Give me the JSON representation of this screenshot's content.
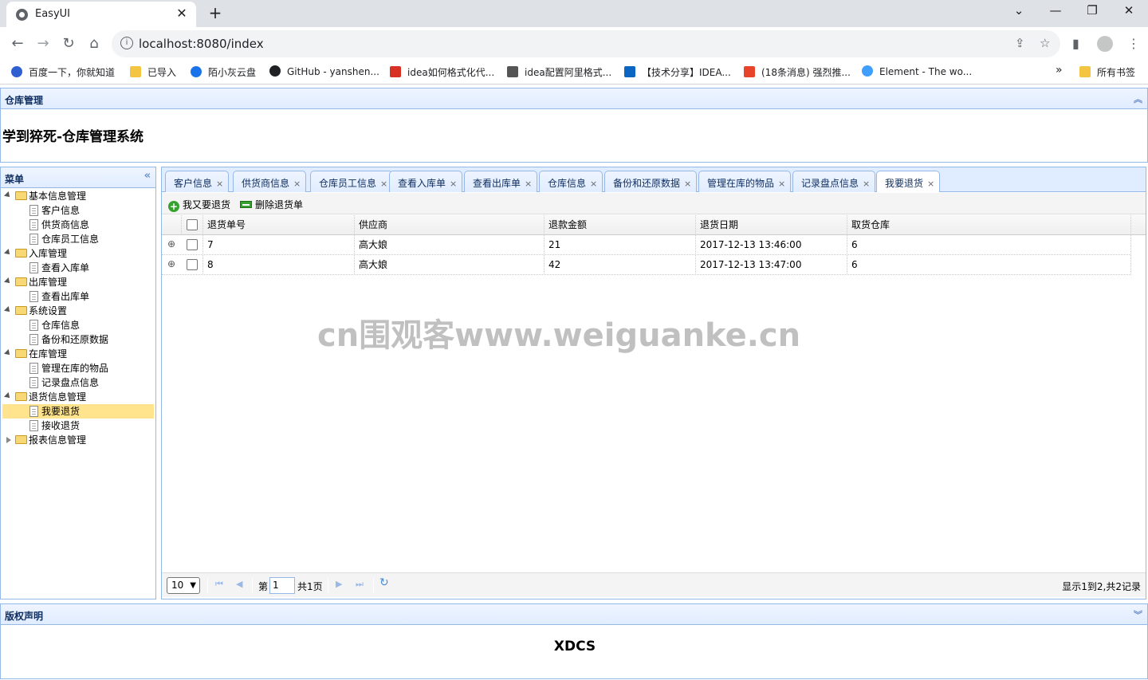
{
  "browser": {
    "tab_title": "EasyUI",
    "tab_close": "✕",
    "new_tab": "+",
    "url": "localhost:8080/index",
    "bookmarks": [
      {
        "label": "百度一下，你就知道",
        "color": "#2f5fd0"
      },
      {
        "label": "已导入",
        "color": "#f4c542"
      },
      {
        "label": "陌小灰云盘",
        "color": "#1a73e8"
      },
      {
        "label": "GitHub - yanshen...",
        "color": "#202124"
      },
      {
        "label": "idea如何格式化代...",
        "color": "#d93025"
      },
      {
        "label": "idea配置阿里格式...",
        "color": "#555555"
      },
      {
        "label": "【技术分享】IDEA...",
        "color": "#0a66c2"
      },
      {
        "label": "(18条消息) 强烈推...",
        "color": "#e8442a"
      },
      {
        "label": "Element - The wo...",
        "color": "#409eff"
      }
    ],
    "bookmarks_more": "»",
    "all_bookmarks": "所有书签"
  },
  "header": {
    "title": "仓库管理",
    "system_name": "学到猝死-仓库管理系统"
  },
  "menu": {
    "title": "菜单",
    "nodes": [
      {
        "label": "基本信息管理",
        "type": "folder",
        "level": 0,
        "open": true
      },
      {
        "label": "客户信息",
        "type": "file",
        "level": 1
      },
      {
        "label": "供货商信息",
        "type": "file",
        "level": 1
      },
      {
        "label": "仓库员工信息",
        "type": "file",
        "level": 1
      },
      {
        "label": "入库管理",
        "type": "folder",
        "level": 0,
        "open": true
      },
      {
        "label": "查看入库单",
        "type": "file",
        "level": 1
      },
      {
        "label": "出库管理",
        "type": "folder",
        "level": 0,
        "open": true
      },
      {
        "label": "查看出库单",
        "type": "file",
        "level": 1
      },
      {
        "label": "系统设置",
        "type": "folder",
        "level": 0,
        "open": true
      },
      {
        "label": "仓库信息",
        "type": "file",
        "level": 1
      },
      {
        "label": "备份和还原数据",
        "type": "file",
        "level": 1
      },
      {
        "label": "在库管理",
        "type": "folder",
        "level": 0,
        "open": true
      },
      {
        "label": "管理在库的物品",
        "type": "file",
        "level": 1
      },
      {
        "label": "记录盘点信息",
        "type": "file",
        "level": 1
      },
      {
        "label": "退货信息管理",
        "type": "folder",
        "level": 0,
        "open": true
      },
      {
        "label": "我要退货",
        "type": "file",
        "level": 1,
        "selected": true
      },
      {
        "label": "接收退货",
        "type": "file",
        "level": 1
      },
      {
        "label": "报表信息管理",
        "type": "folder",
        "level": 0,
        "open": false
      }
    ]
  },
  "tabs": [
    {
      "label": "客户信息"
    },
    {
      "label": "供货商信息"
    },
    {
      "label": "仓库员工信息"
    },
    {
      "label": "查看入库单"
    },
    {
      "label": "查看出库单"
    },
    {
      "label": "仓库信息"
    },
    {
      "label": "备份和还原数据"
    },
    {
      "label": "管理在库的物品"
    },
    {
      "label": "记录盘点信息"
    },
    {
      "label": "我要退货",
      "active": true
    }
  ],
  "tab_close_glyph": "×",
  "grid": {
    "toolbar": {
      "add_label": "我又要退货",
      "delete_label": "删除退货单"
    },
    "columns": [
      "退货单号",
      "供应商",
      "退款金额",
      "退货日期",
      "取货仓库"
    ],
    "rows": [
      [
        "7",
        "高大娘",
        "21",
        "2017-12-13 13:46:00",
        "6"
      ],
      [
        "8",
        "高大娘",
        "42",
        "2017-12-13 13:47:00",
        "6"
      ]
    ],
    "pager": {
      "page_size": "10",
      "page_prefix": "第",
      "page_value": "1",
      "page_total": "共1页",
      "summary": "显示1到2,共2记录"
    }
  },
  "watermark": "cn围观客www.weiguanke.cn",
  "footer": {
    "title": "版权声明",
    "text": "XDCS"
  }
}
